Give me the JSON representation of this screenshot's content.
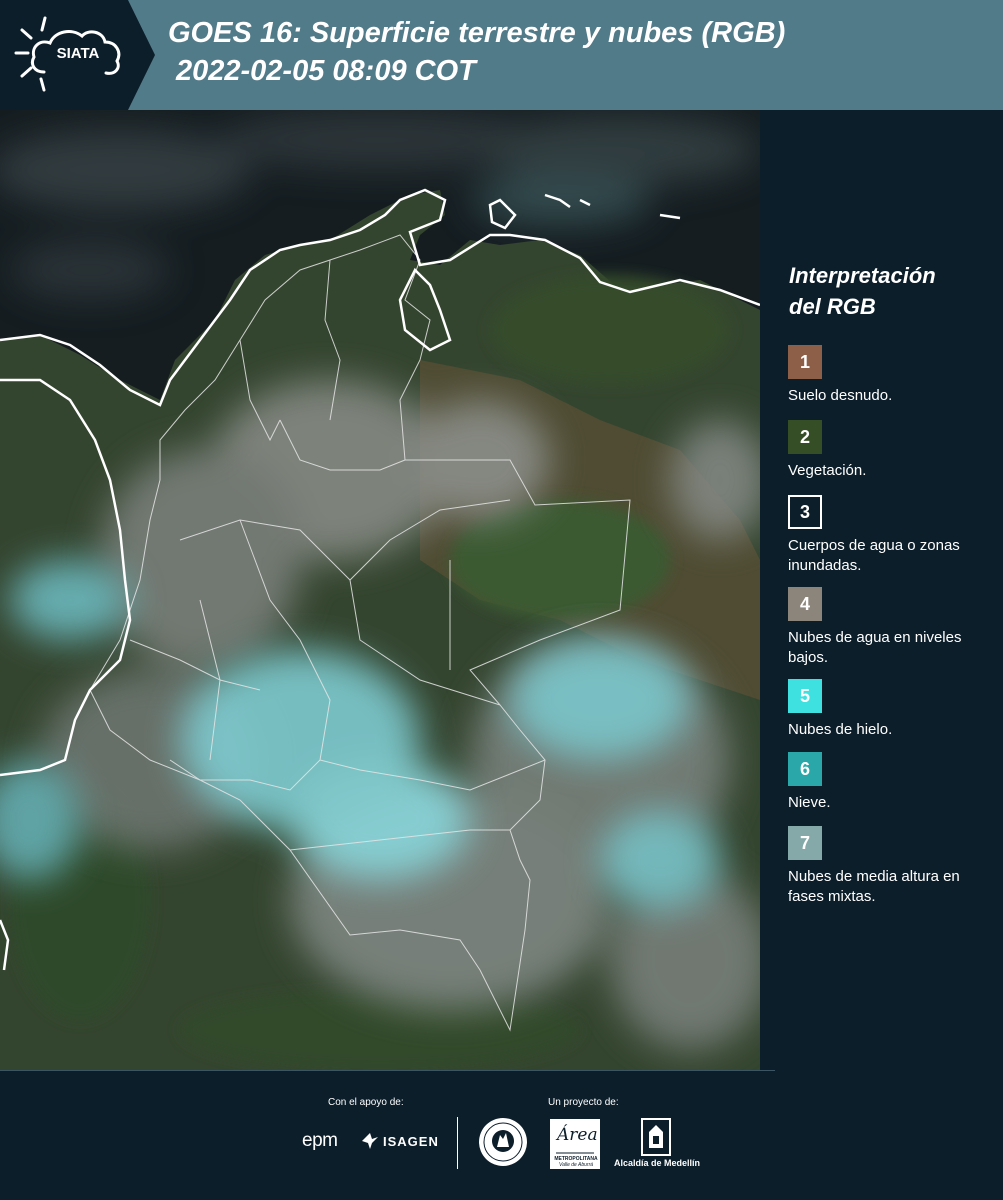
{
  "header": {
    "logo_text": "SIATA",
    "title_line1": "GOES 16: Superficie terrestre y nubes (RGB)",
    "title_line2": "2022-02-05 08:09 COT"
  },
  "legend": {
    "title_line1": "Interpretación",
    "title_line2": "del RGB",
    "items": [
      {
        "number": "1",
        "label": "Suelo desnudo.",
        "color": "#8d5e48"
      },
      {
        "number": "2",
        "label": "Vegetación.",
        "color": "#364e25"
      },
      {
        "number": "3",
        "label": "Cuerpos de agua o zonas inundadas.",
        "color": "#0d1e2b"
      },
      {
        "number": "4",
        "label": "Nubes de agua en niveles bajos.",
        "color": "#8c857b"
      },
      {
        "number": "5",
        "label": "Nubes de hielo.",
        "color": "#3fe0e0"
      },
      {
        "number": "6",
        "label": "Nieve.",
        "color": "#2aa7a8"
      },
      {
        "number": "7",
        "label": "Nubes de media altura en fases mixtas.",
        "color": "#85a8a9"
      }
    ]
  },
  "footer": {
    "support_label": "Con el apoyo de:",
    "project_label": "Un proyecto de:",
    "epm": "epm",
    "isagen": "ISAGEN",
    "area_script": "Área",
    "area_small1": "METROPOLITANA",
    "area_small2": "Valle de Aburrá",
    "alcaldia": "Alcaldía de Medellín"
  },
  "colors": {
    "header_bg": "#527b89",
    "panel_bg": "#0d1e2b",
    "ocean": "#12191d",
    "vegetation": "#2f4a2a",
    "bare_soil": "#5a5233",
    "clouds_low": "#8d8f8a",
    "clouds_ice": "#7fd1d6"
  }
}
